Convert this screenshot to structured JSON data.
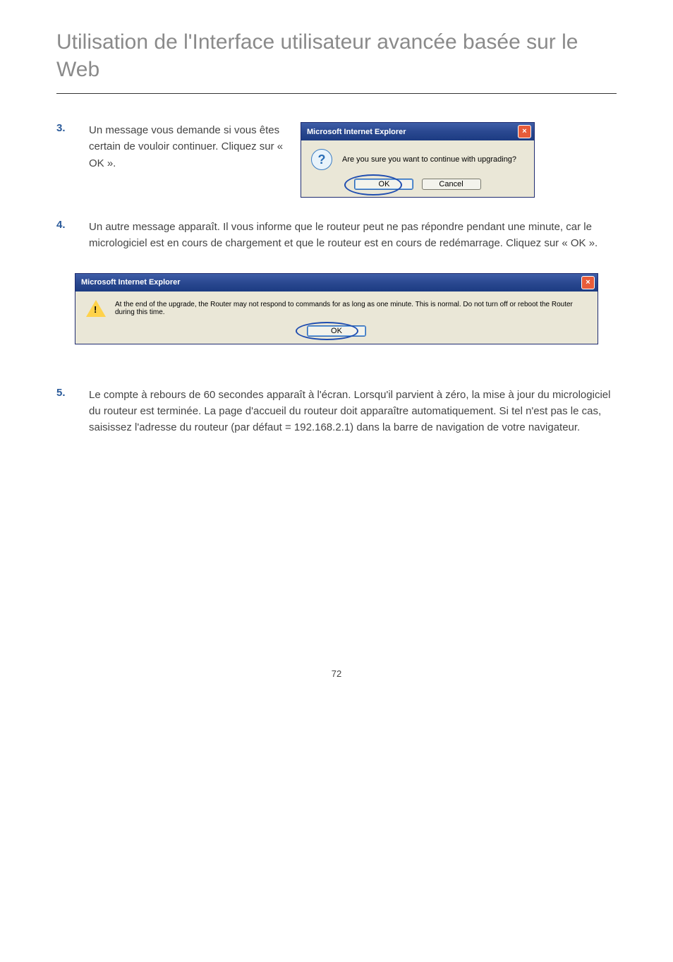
{
  "header": {
    "title": "Utilisation de l'Interface utilisateur avancée basée sur le Web"
  },
  "steps": {
    "s3": {
      "num": "3.",
      "text": "Un message vous demande si vous êtes certain de vouloir continuer. Cliquez sur « OK »."
    },
    "s4": {
      "num": "4.",
      "text": "Un autre message apparaît. Il vous informe que le routeur peut ne pas répondre pendant une minute, car le micrologiciel est en cours de chargement et que le routeur est en cours de redémarrage. Cliquez sur « OK »."
    },
    "s5": {
      "num": "5.",
      "text": "Le compte à rebours de 60 secondes apparaît à l'écran. Lorsqu'il parvient à zéro, la mise à jour du micrologiciel du routeur est terminée. La page d'accueil du routeur doit apparaître automatiquement. Si tel n'est pas le cas, saisissez l'adresse du routeur (par défaut = 192.168.2.1) dans la barre de navigation de votre navigateur."
    }
  },
  "dialog1": {
    "title": "Microsoft Internet Explorer",
    "close": "×",
    "message": "Are you sure you want to continue with upgrading?",
    "ok": "OK",
    "cancel": "Cancel"
  },
  "dialog2": {
    "title": "Microsoft Internet Explorer",
    "close": "×",
    "message": "At the end of the upgrade, the Router may not respond to commands for as long as one minute. This is normal. Do not turn off or reboot the Router during this time.",
    "ok": "OK"
  },
  "footer": {
    "page": "72"
  }
}
